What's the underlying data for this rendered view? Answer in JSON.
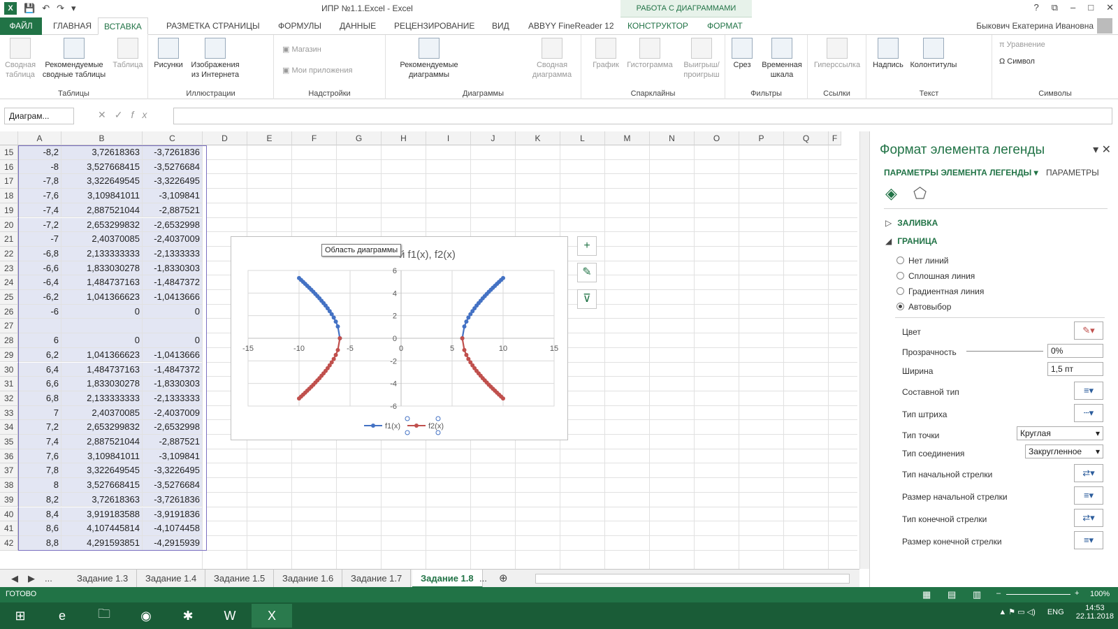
{
  "window": {
    "title": "ИПР №1.1.Excel - Excel",
    "context_tab": "РАБОТА С ДИАГРАММАМИ",
    "controls": [
      "?",
      "⧉",
      "–",
      "□",
      "✕"
    ]
  },
  "tabs": {
    "file": "ФАЙЛ",
    "items": [
      "ГЛАВНАЯ",
      "ВСТАВКА",
      "РАЗМЕТКА СТРАНИЦЫ",
      "ФОРМУЛЫ",
      "ДАННЫЕ",
      "РЕЦЕНЗИРОВАНИЕ",
      "ВИД",
      "ABBYY FineReader 12",
      "КОНСТРУКТОР",
      "ФОРМАТ"
    ],
    "user": "Быкович Екатерина Ивановна"
  },
  "ribbon": {
    "pivot": "Сводная таблица",
    "rec_pivot": "Рекомендуемые сводные таблицы",
    "table": "Таблица",
    "g_tables": "Таблицы",
    "pictures": "Рисунки",
    "online": "Изображения из Интернета",
    "g_illus": "Иллюстрации",
    "store": "Магазин",
    "myapps": "Мои приложения",
    "g_addins": "Надстройки",
    "rec_charts": "Рекомендуемые диаграммы",
    "pivot_chart": "Сводная диаграмма",
    "g_charts": "Диаграммы",
    "line": "График",
    "column": "Гистограмма",
    "winloss": "Выигрыш/ проигрыш",
    "g_spark": "Спарклайны",
    "slicer": "Срез",
    "timeline": "Временная шкала",
    "g_filters": "Фильтры",
    "hyperlink": "Гиперссылка",
    "g_links": "Ссылки",
    "textbox": "Надпись",
    "headfoot": "Колонтитулы",
    "g_text": "Текст",
    "equation": "Уравнение",
    "symbol": "Символ",
    "g_symbols": "Символы"
  },
  "formula": {
    "namebox": "Диаграм...",
    "fx": "fx"
  },
  "grid": {
    "columns": [
      "A",
      "B",
      "C",
      "D",
      "E",
      "F",
      "G",
      "H",
      "I",
      "J",
      "K",
      "L",
      "M",
      "N",
      "O",
      "P",
      "Q",
      "F"
    ],
    "rows": [
      {
        "n": "15",
        "a": "-8,2",
        "b": "3,72618363",
        "c": "-3,7261836"
      },
      {
        "n": "16",
        "a": "-8",
        "b": "3,527668415",
        "c": "-3,5276684"
      },
      {
        "n": "17",
        "a": "-7,8",
        "b": "3,322649545",
        "c": "-3,3226495"
      },
      {
        "n": "18",
        "a": "-7,6",
        "b": "3,109841011",
        "c": "-3,109841"
      },
      {
        "n": "19",
        "a": "-7,4",
        "b": "2,887521044",
        "c": "-2,887521"
      },
      {
        "n": "20",
        "a": "-7,2",
        "b": "2,653299832",
        "c": "-2,6532998"
      },
      {
        "n": "21",
        "a": "-7",
        "b": "2,40370085",
        "c": "-2,4037009"
      },
      {
        "n": "22",
        "a": "-6,8",
        "b": "2,133333333",
        "c": "-2,1333333"
      },
      {
        "n": "23",
        "a": "-6,6",
        "b": "1,833030278",
        "c": "-1,8330303"
      },
      {
        "n": "24",
        "a": "-6,4",
        "b": "1,484737163",
        "c": "-1,4847372"
      },
      {
        "n": "25",
        "a": "-6,2",
        "b": "1,041366623",
        "c": "-1,0413666"
      },
      {
        "n": "26",
        "a": "-6",
        "b": "0",
        "c": "0"
      },
      {
        "n": "27",
        "a": "",
        "b": "",
        "c": ""
      },
      {
        "n": "28",
        "a": "6",
        "b": "0",
        "c": "0"
      },
      {
        "n": "29",
        "a": "6,2",
        "b": "1,041366623",
        "c": "-1,0413666"
      },
      {
        "n": "30",
        "a": "6,4",
        "b": "1,484737163",
        "c": "-1,4847372"
      },
      {
        "n": "31",
        "a": "6,6",
        "b": "1,833030278",
        "c": "-1,8330303"
      },
      {
        "n": "32",
        "a": "6,8",
        "b": "2,133333333",
        "c": "-2,1333333"
      },
      {
        "n": "33",
        "a": "7",
        "b": "2,40370085",
        "c": "-2,4037009"
      },
      {
        "n": "34",
        "a": "7,2",
        "b": "2,653299832",
        "c": "-2,6532998"
      },
      {
        "n": "35",
        "a": "7,4",
        "b": "2,887521044",
        "c": "-2,887521"
      },
      {
        "n": "36",
        "a": "7,6",
        "b": "3,109841011",
        "c": "-3,109841"
      },
      {
        "n": "37",
        "a": "7,8",
        "b": "3,322649545",
        "c": "-3,3226495"
      },
      {
        "n": "38",
        "a": "8",
        "b": "3,527668415",
        "c": "-3,5276684"
      },
      {
        "n": "39",
        "a": "8,2",
        "b": "3,72618363",
        "c": "-3,7261836"
      },
      {
        "n": "40",
        "a": "8,4",
        "b": "3,919183588",
        "c": "-3,9191836"
      },
      {
        "n": "41",
        "a": "8,6",
        "b": "4,107445814",
        "c": "-4,1074458"
      },
      {
        "n": "42",
        "a": "8,8",
        "b": "4,291593851",
        "c": "-4,2915939"
      }
    ]
  },
  "chart": {
    "title_visible": "й f1(x), f2(x)",
    "tooltip": "Область диаграммы",
    "buttons": [
      "+",
      "✎",
      "⊽"
    ]
  },
  "chart_data": {
    "type": "scatter",
    "title": "й f1(x), f2(x)",
    "xlim": [
      -15,
      15
    ],
    "ylim": [
      -6,
      6
    ],
    "x_ticks": [
      -15,
      -10,
      -5,
      0,
      5,
      10,
      15
    ],
    "y_ticks": [
      -6,
      -4,
      -2,
      0,
      2,
      4,
      6
    ],
    "grid": true,
    "legend": "bottom",
    "series": [
      {
        "name": "f1(x)",
        "color": "#4472c4",
        "x": [
          -10,
          -9.8,
          -9.6,
          -9.4,
          -9.2,
          -9,
          -8.8,
          -8.6,
          -8.4,
          -8.2,
          -8,
          -7.8,
          -7.6,
          -7.4,
          -7.2,
          -7,
          -6.8,
          -6.6,
          -6.4,
          -6.2,
          -6,
          6,
          6.2,
          6.4,
          6.6,
          6.8,
          7,
          7.2,
          7.4,
          7.6,
          7.8,
          8,
          8.2,
          8.4,
          8.6,
          8.8,
          9,
          9.2,
          9.4,
          9.6,
          9.8,
          10
        ],
        "y": [
          5.33,
          5.16,
          4.99,
          4.82,
          4.64,
          4.47,
          4.29,
          4.11,
          3.92,
          3.73,
          3.53,
          3.32,
          3.11,
          2.89,
          2.65,
          2.4,
          2.13,
          1.83,
          1.48,
          1.04,
          0,
          0,
          1.04,
          1.48,
          1.83,
          2.13,
          2.4,
          2.65,
          2.89,
          3.11,
          3.32,
          3.53,
          3.73,
          3.92,
          4.11,
          4.29,
          4.47,
          4.64,
          4.82,
          4.99,
          5.16,
          5.33
        ]
      },
      {
        "name": "f2(x)",
        "color": "#c0504d",
        "x": [
          -10,
          -9.8,
          -9.6,
          -9.4,
          -9.2,
          -9,
          -8.8,
          -8.6,
          -8.4,
          -8.2,
          -8,
          -7.8,
          -7.6,
          -7.4,
          -7.2,
          -7,
          -6.8,
          -6.6,
          -6.4,
          -6.2,
          -6,
          6,
          6.2,
          6.4,
          6.6,
          6.8,
          7,
          7.2,
          7.4,
          7.6,
          7.8,
          8,
          8.2,
          8.4,
          8.6,
          8.8,
          9,
          9.2,
          9.4,
          9.6,
          9.8,
          10
        ],
        "y": [
          -5.33,
          -5.16,
          -4.99,
          -4.82,
          -4.64,
          -4.47,
          -4.29,
          -4.11,
          -3.92,
          -3.73,
          -3.53,
          -3.32,
          -3.11,
          -2.89,
          -2.65,
          -2.4,
          -2.13,
          -1.83,
          -1.48,
          -1.04,
          0,
          0,
          -1.04,
          -1.48,
          -1.83,
          -2.13,
          -2.4,
          -2.65,
          -2.89,
          -3.11,
          -3.32,
          -3.53,
          -3.73,
          -3.92,
          -4.11,
          -4.29,
          -4.47,
          -4.64,
          -4.82,
          -4.99,
          -5.16,
          -5.33
        ]
      }
    ]
  },
  "sheet_tabs": {
    "nav": [
      "◀",
      "▶",
      "..."
    ],
    "items": [
      "Задание 1.3",
      "Задание 1.4",
      "Задание 1.5",
      "Задание 1.6",
      "Задание 1.7",
      "Задание 1.8"
    ],
    "more": "...",
    "add": "⊕"
  },
  "status": {
    "ready": "ГОТОВО",
    "zoom": "100%"
  },
  "taskbar": {
    "lang": "ENG",
    "time": "14:53",
    "date": "22.11.2018"
  },
  "pane": {
    "title": "Формат элемента легенды",
    "tab1": "ПАРАМЕТРЫ ЭЛЕМЕНТА ЛЕГЕНДЫ",
    "tab2": "ПАРАМЕТРЫ",
    "fill": "ЗАЛИВКА",
    "border": "ГРАНИЦА",
    "radios": [
      "Нет линий",
      "Сплошная линия",
      "Градиентная линия",
      "Автовыбор"
    ],
    "color": "Цвет",
    "transparency": "Прозрачность",
    "transparency_val": "0%",
    "width": "Ширина",
    "width_val": "1,5 пт",
    "compound": "Составной тип",
    "dash": "Тип штриха",
    "cap": "Тип точки",
    "cap_val": "Круглая",
    "join": "Тип соединения",
    "join_val": "Закругленное",
    "begin_arrow": "Тип начальной стрелки",
    "begin_size": "Размер начальной стрелки",
    "end_arrow": "Тип конечной стрелки",
    "end_size": "Размер конечной стрелки"
  }
}
